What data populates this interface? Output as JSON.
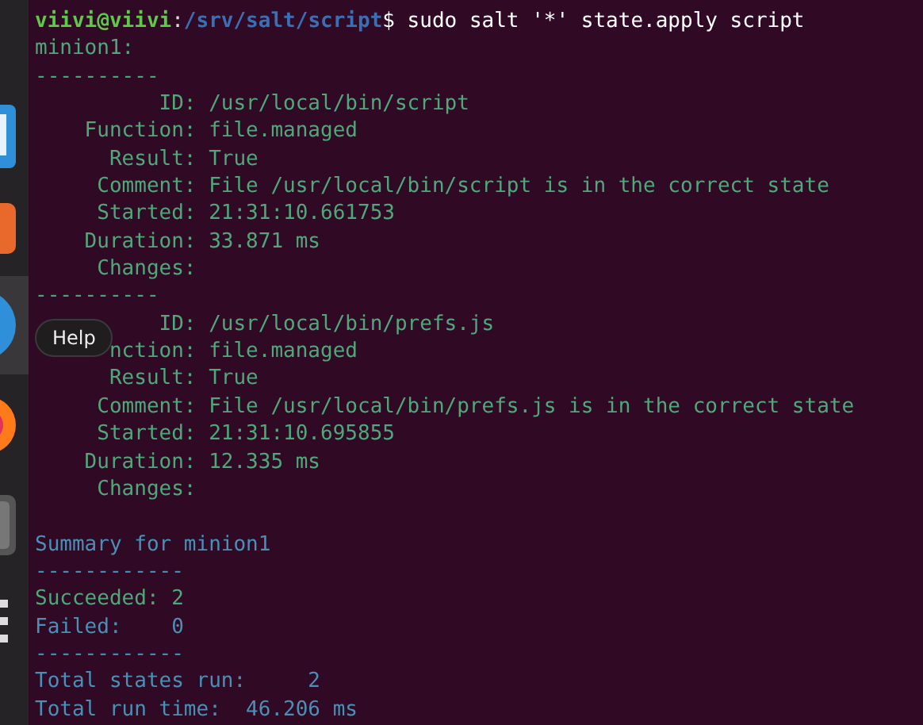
{
  "prompt": {
    "user_host": "viivi@viivi",
    "separator": ":",
    "path": "/srv/salt/script",
    "symbol": "$",
    "command": "sudo salt '*' state.apply script"
  },
  "lines": [
    {
      "kind": "state",
      "text": "minion1:"
    },
    {
      "kind": "state",
      "text": "----------"
    },
    {
      "kind": "state",
      "text": "          ID: /usr/local/bin/script"
    },
    {
      "kind": "state",
      "text": "    Function: file.managed"
    },
    {
      "kind": "state",
      "text": "      Result: True"
    },
    {
      "kind": "state",
      "text": "     Comment: File /usr/local/bin/script is in the correct state"
    },
    {
      "kind": "state",
      "text": "     Started: 21:31:10.661753"
    },
    {
      "kind": "state",
      "text": "    Duration: 33.871 ms"
    },
    {
      "kind": "state",
      "text": "     Changes:"
    },
    {
      "kind": "state",
      "text": "----------"
    },
    {
      "kind": "state",
      "text": "          ID: /usr/local/bin/prefs.js"
    },
    {
      "kind": "state",
      "text": "      nction: file.managed"
    },
    {
      "kind": "state",
      "text": "      Result: True"
    },
    {
      "kind": "state",
      "text": "     Comment: File /usr/local/bin/prefs.js is in the correct state"
    },
    {
      "kind": "state",
      "text": "     Started: 21:31:10.695855"
    },
    {
      "kind": "state",
      "text": "    Duration: 12.335 ms"
    },
    {
      "kind": "state",
      "text": "     Changes:"
    },
    {
      "kind": "blank"
    },
    {
      "kind": "summary",
      "text": "Summary for minion1"
    },
    {
      "kind": "summary",
      "text": "------------"
    },
    {
      "kind": "success",
      "text": "Succeeded: 2"
    },
    {
      "kind": "summary",
      "text": "Failed:    0"
    },
    {
      "kind": "summary",
      "text": "------------"
    },
    {
      "kind": "summary",
      "text": "Total states run:     2"
    },
    {
      "kind": "summary",
      "text": "Total run time:  46.206 ms"
    }
  ],
  "tooltip": "Help"
}
